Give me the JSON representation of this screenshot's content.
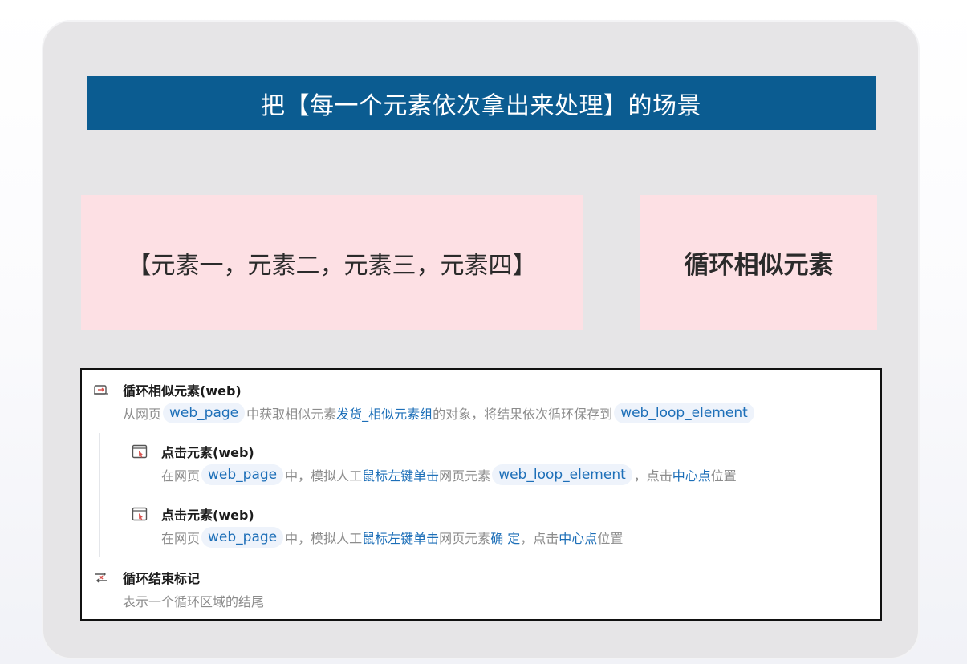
{
  "banner": {
    "title": "把【每一个元素依次拿出来处理】的场景"
  },
  "scene": {
    "elements_text": "【元素一，元素二，元素三，元素四】",
    "loop_label": "循环相似元素"
  },
  "flow": {
    "step1": {
      "icon": "loop-icon",
      "title": "循环相似元素(web)",
      "desc_prefix": "从网页",
      "chip1": "web_page",
      "desc_mid": "中获取相似元素",
      "link1": "发货_相似元素组",
      "desc_mid2": "的对象，将结果依次循环保存到",
      "chip2": "web_loop_element"
    },
    "step2": {
      "icon": "click-element-icon",
      "title": "点击元素(web)",
      "desc_prefix": "在网页",
      "chip1": "web_page",
      "desc_mid": "中，模拟人工",
      "link1": "鼠标左键单击",
      "desc_mid2": "网页元素",
      "chip2": "web_loop_element",
      "desc_mid3": "，点击",
      "link2": "中心点",
      "desc_suffix": "位置"
    },
    "step3": {
      "icon": "click-element-icon",
      "title": "点击元素(web)",
      "desc_prefix": "在网页",
      "chip1": "web_page",
      "desc_mid": "中，模拟人工",
      "link1": "鼠标左键单击",
      "desc_mid2": "网页元素",
      "link_confirm": "确 定",
      "desc_mid3": "，点击",
      "link2": "中心点",
      "desc_suffix": "位置"
    },
    "step4": {
      "icon": "loop-end-icon",
      "title": "循环结束标记",
      "desc": "表示一个循环区域的结尾"
    }
  },
  "colors": {
    "banner": "#0b5c91",
    "pink": "#fde0e4",
    "card": "#e6e5e7",
    "link": "#1d6fb8",
    "chip_bg": "#eef3fb"
  }
}
